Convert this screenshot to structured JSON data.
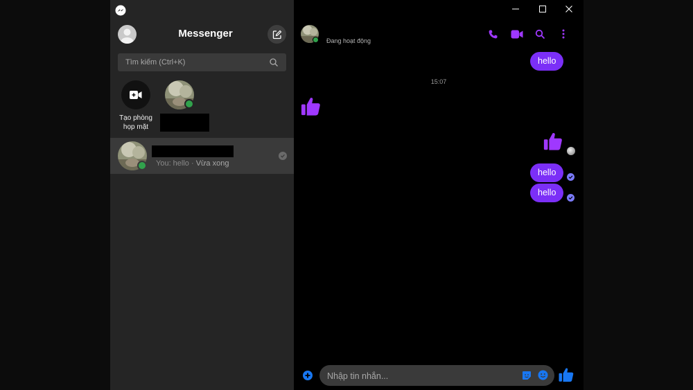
{
  "colors": {
    "accent": "#7b2ff7",
    "icon_purple": "#9f38ff",
    "blue": "#1877f2",
    "online": "#31a24c"
  },
  "sidebar": {
    "app_icon": "messenger-logo-icon",
    "title": "Messenger",
    "search": {
      "placeholder": "Tìm kiếm (Ctrl+K)"
    },
    "create_room": {
      "label": "Tạo phòng họp mặt",
      "icon": "video-plus-icon"
    },
    "conversations": [
      {
        "preview": "You: hello · ",
        "time": "Vừa xong"
      }
    ]
  },
  "window_controls": [
    "minimize-icon",
    "maximize-icon",
    "close-icon"
  ],
  "chat": {
    "header": {
      "status": "Đang hoạt động",
      "actions": [
        "phone-icon",
        "video-call-icon",
        "search-icon",
        "more-icon"
      ]
    },
    "messages": [
      {
        "text": "hello",
        "from": "me"
      },
      {
        "timestamp": "15:07"
      },
      {
        "type": "like",
        "from": "them"
      },
      {
        "type": "like",
        "from": "me"
      },
      {
        "text": "hello",
        "from": "me"
      },
      {
        "text": "hello",
        "from": "me"
      }
    ],
    "composer": {
      "placeholder": "Nhập tin nhắn...",
      "icons": [
        "plus-circle-icon",
        "sticker-icon",
        "emoji-icon",
        "thumbs-up-icon"
      ]
    }
  }
}
